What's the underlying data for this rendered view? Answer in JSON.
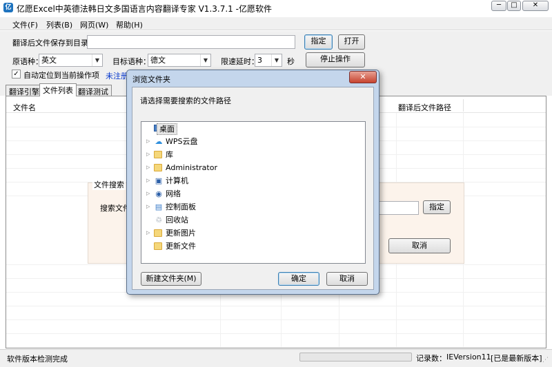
{
  "window": {
    "title": "亿愿Excel中英德法韩日文多国语言内容翻译专家 V1.3.7.1 -亿愿软件",
    "minimize": "─",
    "restore": "□",
    "close": "✕"
  },
  "menu": [
    "文件(F)",
    "列表(B)",
    "网页(W)",
    "帮助(H)"
  ],
  "controls": {
    "save_dir_label": "翻译后文件保存到目录：",
    "save_dir_value": "",
    "specify_button": "指定",
    "open_button": "打开",
    "source_lang_label": "原语种：",
    "source_lang_value": "英文",
    "target_lang_label": "目标语种：",
    "target_lang_value": "德文",
    "delay_label": "限速延时：",
    "delay_value": "3",
    "seconds_label": "秒",
    "stop_button": "停止操作",
    "auto_locate_label": "自动定位到当前操作项",
    "auto_locate_checked": true,
    "unregistered_link": "未注册"
  },
  "tabs": [
    "翻译引擎",
    "文件列表",
    "翻译测试"
  ],
  "active_tab": 1,
  "table": {
    "col_filename": "文件名",
    "col_translated_path": "翻译后文件路径"
  },
  "search_panel": {
    "title": "文件搜索",
    "search_label": "搜索文件",
    "specify_button": "指定",
    "cancel_button": "取消"
  },
  "status": {
    "message": "软件版本检测完成",
    "progress": 0,
    "records_label": "记录数：",
    "ie_version": "IEVersion11",
    "update_status": "[已是最新版本]"
  },
  "dialog": {
    "title": "浏览文件夹",
    "close": "✕",
    "prompt": "请选择需要搜索的文件路径",
    "tree": [
      {
        "label": "桌面",
        "icon": "desktop-icon",
        "expander": "",
        "level": 0,
        "selected": true
      },
      {
        "label": "WPS云盘",
        "icon": "cloud-icon",
        "expander": "▷",
        "level": 1,
        "selected": false
      },
      {
        "label": "库",
        "icon": "library-icon",
        "expander": "▷",
        "level": 1,
        "selected": false
      },
      {
        "label": "Administrator",
        "icon": "user-folder-icon",
        "expander": "▷",
        "level": 1,
        "selected": false
      },
      {
        "label": "计算机",
        "icon": "computer-icon",
        "expander": "▷",
        "level": 1,
        "selected": false
      },
      {
        "label": "网络",
        "icon": "network-icon",
        "expander": "▷",
        "level": 1,
        "selected": false
      },
      {
        "label": "控制面板",
        "icon": "control-panel-icon",
        "expander": "▷",
        "level": 1,
        "selected": false
      },
      {
        "label": "回收站",
        "icon": "recycle-bin-icon",
        "expander": "",
        "level": 1,
        "selected": false
      },
      {
        "label": "更新图片",
        "icon": "folder-icon",
        "expander": "▷",
        "level": 1,
        "selected": false
      },
      {
        "label": "更新文件",
        "icon": "folder-icon",
        "expander": "",
        "level": 1,
        "selected": false
      }
    ],
    "new_folder_button": "新建文件夹(M)",
    "ok_button": "确定",
    "cancel_button": "取消"
  }
}
